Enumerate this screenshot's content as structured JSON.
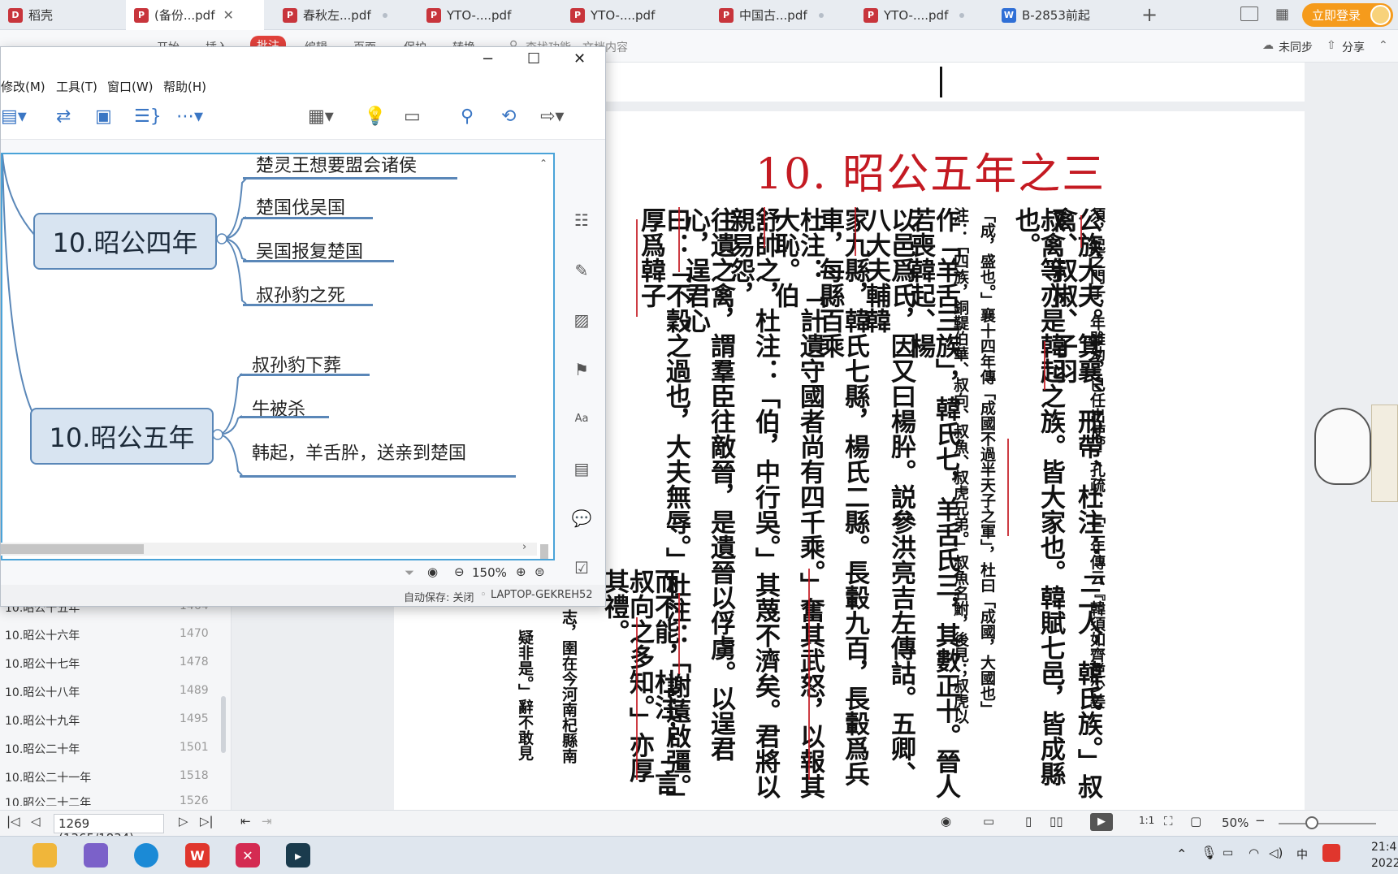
{
  "tabs": [
    {
      "label": "稻壳",
      "sub": "",
      "type": "home"
    },
    {
      "label": "(备份...pdf",
      "sub": "",
      "type": "pdf",
      "active": true
    },
    {
      "label": "春秋左...pdf",
      "sub": "",
      "type": "pdf"
    },
    {
      "label": "YTO-....pdf",
      "sub": "",
      "type": "pdf"
    },
    {
      "label": "YTO-....pdf",
      "sub": "",
      "type": "pdf"
    },
    {
      "label": "中国古...pdf",
      "sub": "",
      "type": "pdf"
    },
    {
      "label": "YTO-....pdf",
      "sub": "",
      "type": "pdf"
    },
    {
      "label": "B-2853前起",
      "sub": "",
      "type": "word"
    }
  ],
  "tab_icon_letters": {
    "pdf": "P",
    "word": "W",
    "home": "D"
  },
  "header": {
    "login": "立即登录",
    "sync": "未同步",
    "share": "分享"
  },
  "ribbon": {
    "items": [
      "开始",
      "插入",
      "批注",
      "编辑",
      "页面",
      "保护",
      "转换"
    ],
    "search_placeholder": "查找功能、文档内容"
  },
  "outline": {
    "items": [
      {
        "label": "10.昭公十五年",
        "page": "1464"
      },
      {
        "label": "10.昭公十六年",
        "page": "1470"
      },
      {
        "label": "10.昭公十七年",
        "page": "1478"
      },
      {
        "label": "10.昭公十八年",
        "page": "1489"
      },
      {
        "label": "10.昭公十九年",
        "page": "1495"
      },
      {
        "label": "10.昭公二十年",
        "page": "1501"
      },
      {
        "label": "10.昭公二十一年",
        "page": "1518"
      },
      {
        "label": "10.昭公二十二年",
        "page": "1526"
      }
    ]
  },
  "document": {
    "title": "10. 昭公五年之三",
    "columns": [
      {
        "text": "須，起之門子，年雖幼，已任出使。」孔疏：「三年傳云『韓須如齊逆少姜",
        "size": "small"
      },
      {
        "text": "公族大夫。箕襄、邢帶、杜注：「二人，韓氏族。」叔禽、叔椒、子羽",
        "size": "big"
      },
      {
        "text": "叔禽等亦是韓起之族。皆大家也。韓賦七邑，皆成縣也。",
        "size": "big"
      },
      {
        "text": "「成，盛也。」襄十四年傳「成國不過半天子之軍」，杜曰「成國，大國也」",
        "size": "small"
      },
      {
        "text": "注：「四族，銅鞮伯華、叔向、叔魚、叔虎兄弟。」叔魚名鮒，後見；叔虎以",
        "size": "small"
      },
      {
        "text": "作「羊舌三族」，韓氏七，羊舌氏三，其數正十。晉人若喪韓起、楊",
        "size": "big"
      },
      {
        "text": "以邑爲氏，因又曰楊肸。説參洪亮吉左傳詁。五卿、八大夫輔韓",
        "size": "big"
      },
      {
        "text": "家九縣，韓氏七縣，楊氏二縣。長轂九百，長轂爲兵車，每縣百乘",
        "size": "big"
      },
      {
        "text": "杜注：「計遺守國者尚有四千乘。」奮其武怒，以報其大恥。伯",
        "size": "big"
      },
      {
        "text": "舒帥之，杜注：「伯，中行吳。」其蔑不濟矣。君將以親易怨，",
        "size": "big"
      },
      {
        "text": "往遺之禽，謂羣臣往敵晉，是遺晉以俘虜。以逞君心，逞君心",
        "size": "big"
      },
      {
        "text": "曰：「不穀之過也，大夫無辱。」杜注：「謝薳啟彊。」厚爲韓子",
        "size": "big"
      },
      {
        "text": "而不能，杜注：「言叔向之多知。」亦厚其禮。",
        "size": "big"
      },
      {
        "text": "志，圉在今河南杞縣南",
        "size": "small"
      },
      {
        "text": "疑非是。」辭不敢見",
        "size": "small"
      }
    ]
  },
  "statusbar": {
    "page_field": "1269 (1365/1834)",
    "zoom": "50%",
    "scale_btn": "1:1"
  },
  "taskbar": {
    "time": "21:4",
    "date": "2022/"
  },
  "xmind": {
    "menu": [
      "修改(M)",
      "工具(T)",
      "窗口(W)",
      "帮助(H)"
    ],
    "topics": [
      {
        "label": "10.昭公四年",
        "children": [
          "楚灵王想要盟会诸侯",
          "楚国伐吴国",
          "吴国报复楚国",
          "叔孙豹之死"
        ]
      },
      {
        "label": "10.昭公五年",
        "children": [
          "叔孙豹下葬",
          "牛被杀",
          "韩起，羊舌肸，送亲到楚国"
        ]
      }
    ],
    "zoom": "150%",
    "autosave": "自动保存: 关闭",
    "device": "LAPTOP-GEKREH52"
  },
  "colors": {
    "accent": "#5a87b8",
    "title_red": "#c41a22",
    "login_orange": "#f59b1c"
  }
}
